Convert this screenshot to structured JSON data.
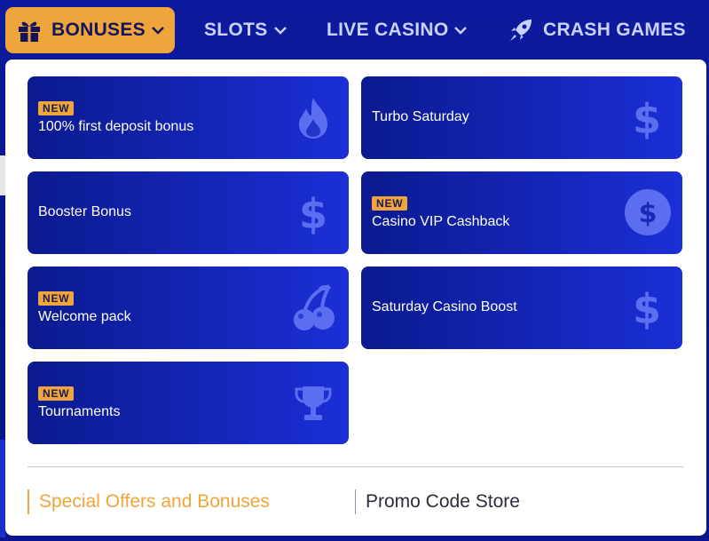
{
  "nav": {
    "items": [
      {
        "label": "BONUSES",
        "icon": "gift-icon",
        "active": true
      },
      {
        "label": "SLOTS",
        "icon": "",
        "active": false
      },
      {
        "label": "LIVE CASINO",
        "icon": "",
        "active": false
      },
      {
        "label": "CRASH GAMES",
        "icon": "rocket-icon",
        "active": false
      }
    ]
  },
  "dropdown": {
    "cards": [
      {
        "badge": "NEW",
        "title": "100% first deposit bonus",
        "icon": "fire-icon"
      },
      {
        "badge": "",
        "title": "Turbo Saturday",
        "icon": "dollar-icon"
      },
      {
        "badge": "",
        "title": "Booster Bonus",
        "icon": "dollar-icon"
      },
      {
        "badge": "NEW",
        "title": "Casino VIP Cashback",
        "icon": "dollar-coin-icon"
      },
      {
        "badge": "NEW",
        "title": "Welcome pack",
        "icon": "cherries-icon"
      },
      {
        "badge": "",
        "title": "Saturday Casino Boost",
        "icon": "dollar-icon"
      },
      {
        "badge": "NEW",
        "title": "Tournaments",
        "icon": "trophy-icon"
      }
    ],
    "footer": {
      "special_offers": "Special Offers and Bonuses",
      "promo_store": "Promo Code Store"
    }
  },
  "colors": {
    "accent": "#f0a53c",
    "nav_bg": "#0d1a9e",
    "card_from": "#0b1a8f",
    "card_to": "#1b2fd6",
    "nav_text": "#c9d2ff"
  }
}
